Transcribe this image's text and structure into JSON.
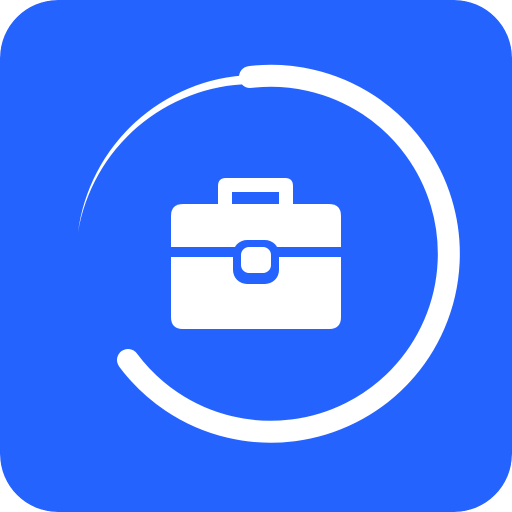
{
  "app_icon": {
    "icon_name": "briefcase-icon",
    "ring_name": "progress-ring-icon",
    "background_color": "#2563FF",
    "foreground_color": "#FFFFFF"
  }
}
